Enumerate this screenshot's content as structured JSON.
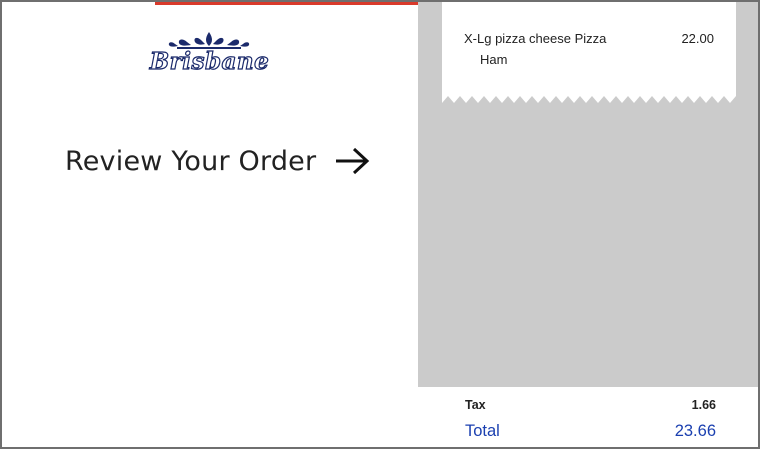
{
  "brand": {
    "logo_text": "Brisbane"
  },
  "review": {
    "label": "Review Your Order",
    "icon": "arrow-right-icon"
  },
  "receipt": {
    "items": [
      {
        "name": "X-Lg pizza cheese Pizza",
        "modifier": "Ham",
        "price": "22.00"
      }
    ],
    "tax_label": "Tax",
    "tax_value": "1.66",
    "total_label": "Total",
    "total_value": "23.66"
  },
  "colors": {
    "accent": "#d93a2b",
    "total_text": "#1a3fb0",
    "logo_ink": "#1b2a6b",
    "receipt_background": "#cbcbcb"
  }
}
